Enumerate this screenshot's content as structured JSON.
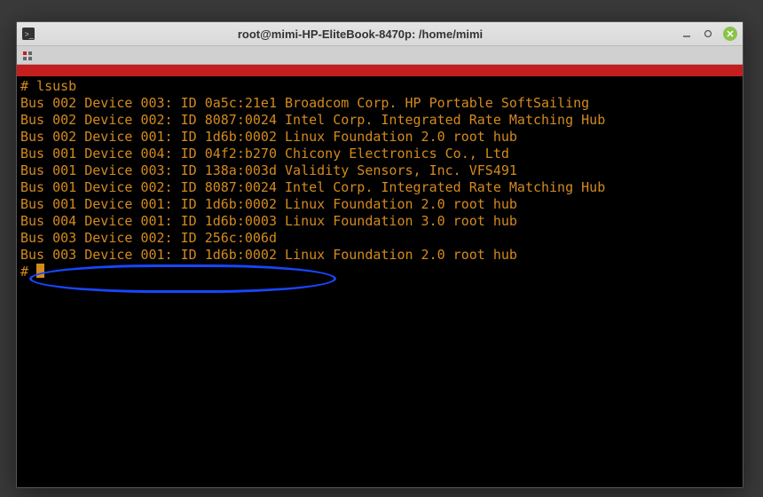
{
  "window": {
    "title": "root@mimi-HP-EliteBook-8470p: /home/mimi"
  },
  "terminal": {
    "prompt": "# ",
    "command": "lsusb",
    "lines": [
      "Bus 002 Device 003: ID 0a5c:21e1 Broadcom Corp. HP Portable SoftSailing",
      "Bus 002 Device 002: ID 8087:0024 Intel Corp. Integrated Rate Matching Hub",
      "Bus 002 Device 001: ID 1d6b:0002 Linux Foundation 2.0 root hub",
      "Bus 001 Device 004: ID 04f2:b270 Chicony Electronics Co., Ltd",
      "Bus 001 Device 003: ID 138a:003d Validity Sensors, Inc. VFS491",
      "Bus 001 Device 002: ID 8087:0024 Intel Corp. Integrated Rate Matching Hub",
      "Bus 001 Device 001: ID 1d6b:0002 Linux Foundation 2.0 root hub",
      "Bus 004 Device 001: ID 1d6b:0003 Linux Foundation 3.0 root hub",
      "Bus 003 Device 002: ID 256c:006d",
      "Bus 003 Device 001: ID 1d6b:0002 Linux Foundation 2.0 root hub"
    ],
    "final_prompt": "# "
  },
  "annotation": {
    "highlight_index": 8,
    "color": "#1746ff"
  },
  "colors": {
    "terminal_bg": "#000000",
    "terminal_fg": "#d38a1e",
    "titlebar_red": "#c41e1e",
    "close_btn": "#8bc34a"
  }
}
